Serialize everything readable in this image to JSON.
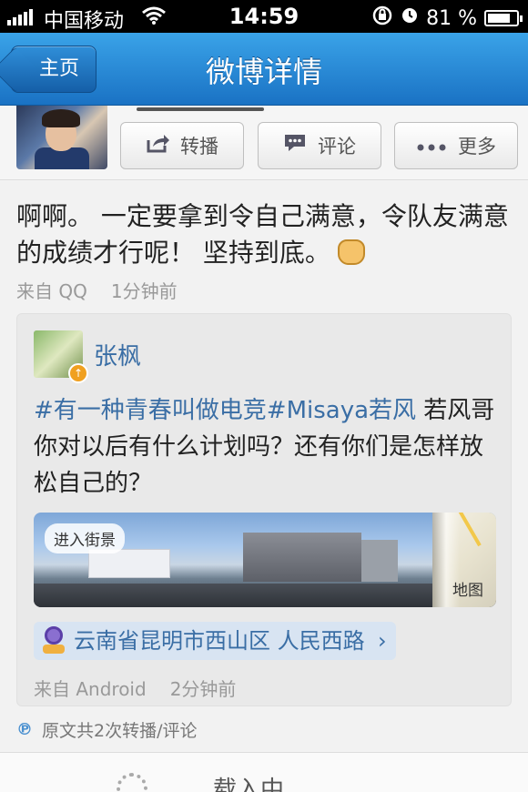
{
  "status_bar": {
    "carrier": "中国移动",
    "time": "14:59",
    "battery_percent": "81 %",
    "battery_level": 0.81
  },
  "nav": {
    "back_label": "主页",
    "title": "微博详情"
  },
  "actions": {
    "repost_label": "转播",
    "comment_label": "评论",
    "more_label": "更多"
  },
  "post": {
    "text": "啊啊。 一定要拿到令自己满意，令队友满意的成绩才行呢！ 坚持到底。",
    "source": "来自 QQ",
    "time": "1分钟前"
  },
  "retweet": {
    "author": "张枫",
    "tag": "#有一种青春叫做电竞#Misaya若风",
    "text": " 若风哥你对以后有什么计划吗？还有你们是怎样放松自己的？",
    "street_view_label": "进入街景",
    "map_label": "地图",
    "location": "云南省昆明市西山区 人民西路",
    "source": "来自 Android",
    "time": "2分钟前"
  },
  "footer": {
    "summary": "原文共2次转播/评论"
  },
  "loading": {
    "text": "载入中"
  }
}
